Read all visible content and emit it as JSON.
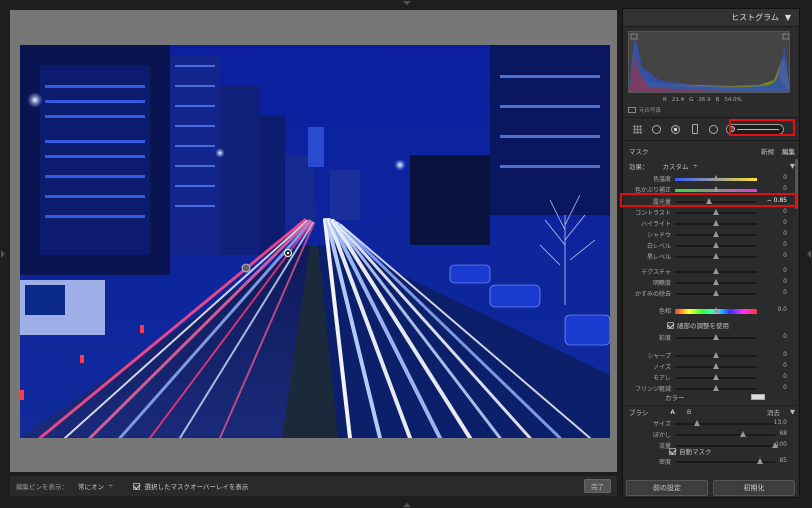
{
  "panel": {
    "histogram_title": "ヒストグラム",
    "rgb": {
      "r_label": "R",
      "r": "21.4",
      "g_label": "G",
      "g": "26.9",
      "b_label": "B",
      "b": "54.0%"
    },
    "original_photo_label": "元の写真",
    "mask": {
      "label": "マスク",
      "new": "新規",
      "edit": "編集"
    },
    "effect": {
      "label": "効果：",
      "value": "カスタム"
    },
    "sliders": [
      {
        "name": "色温度",
        "value": "0",
        "knob": 0.5
      },
      {
        "name": "色かぶり補正",
        "value": "0",
        "knob": 0.5
      },
      {
        "name": "露光量",
        "value": "− 0.85",
        "knob": 0.42
      },
      {
        "name": "コントラスト",
        "value": "0",
        "knob": 0.5
      },
      {
        "name": "ハイライト",
        "value": "0",
        "knob": 0.5
      },
      {
        "name": "シャドウ",
        "value": "0",
        "knob": 0.5
      },
      {
        "name": "白レベル",
        "value": "0",
        "knob": 0.5
      },
      {
        "name": "黒レベル",
        "value": "0",
        "knob": 0.5
      },
      {
        "name": "テクスチャ",
        "value": "0",
        "knob": 0.5
      },
      {
        "name": "明瞭度",
        "value": "0",
        "knob": 0.5
      },
      {
        "name": "かすみの除去",
        "value": "0",
        "knob": 0.5
      },
      {
        "name": "色相",
        "value": "0.0",
        "knob": 0.5
      },
      {
        "name": "彩度",
        "value": "0",
        "knob": 0.5
      },
      {
        "name": "シャープ",
        "value": "0",
        "knob": 0.5
      },
      {
        "name": "ノイズ",
        "value": "0",
        "knob": 0.5
      },
      {
        "name": "モアレ",
        "value": "0",
        "knob": 0.5
      },
      {
        "name": "フリンジ軽減",
        "value": "0",
        "knob": 0.5
      }
    ],
    "fine_adjust_label": "細部の調整を使用",
    "color_label": "カラー",
    "brush": {
      "label": "ブラシ",
      "a": "A",
      "b": "B",
      "erase": "消去",
      "size_label": "サイズ",
      "size": "13.0",
      "size_knob": 0.22,
      "feather_label": "ぼかし",
      "feather": "68",
      "feather_knob": 0.68,
      "flow_label": "流量",
      "flow": "100",
      "flow_knob": 1.0,
      "automask_label": "自動マスク",
      "density_label": "密度",
      "density": "85",
      "density_knob": 0.85
    },
    "prev_settings_button": "前の設定",
    "reset_button": "初期化"
  },
  "toolbar": {
    "show_pins_label": "編集ピンを表示：",
    "show_pins_value": "常にオン",
    "overlay_label": "選択したマスクオーバーレイを表示",
    "done_label": "完了"
  }
}
